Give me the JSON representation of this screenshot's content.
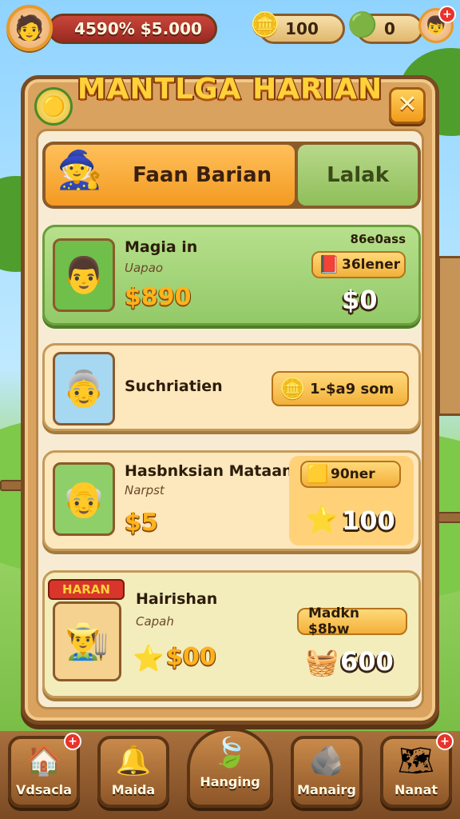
{
  "hud": {
    "money": "4590% $5.000",
    "coins": "100",
    "gems": "0"
  },
  "panel": {
    "title": "MANTLGA HARIAN"
  },
  "tabs": [
    {
      "label": "Faan Barian",
      "active": true
    },
    {
      "label": "Lalak",
      "active": false
    }
  ],
  "quests": [
    {
      "name": "Magia in",
      "subtitle": "Uapao",
      "money": "$890",
      "tag_top": "86e0ass",
      "chip": "36lener",
      "reward": "$0"
    },
    {
      "name": "Suchriatien",
      "chip": "1-$a9 som"
    },
    {
      "name": "Hasbnksian Mataanks",
      "subtitle": "Narpst",
      "money": "$5",
      "chip": "90ner",
      "reward": "100"
    },
    {
      "name": "Hairishan",
      "subtitle": "Capah",
      "banner": "HARAN",
      "money": "$00",
      "chip": "Madkn $8bw",
      "reward": "600"
    }
  ],
  "nav": [
    {
      "label": "Vdsacla",
      "icon": "house-icon",
      "badge": "+"
    },
    {
      "label": "Maida",
      "icon": "bell-icon"
    },
    {
      "label": "Hanging",
      "icon": "leaf-icon"
    },
    {
      "label": "Manairg",
      "icon": "stone-icon"
    },
    {
      "label": "Nanat",
      "icon": "map-icon",
      "badge": "+"
    }
  ],
  "colors": {
    "accent": "#f39a22",
    "panel": "#d9a25f",
    "green_card": "#93c968",
    "badge": "#e8322a"
  }
}
